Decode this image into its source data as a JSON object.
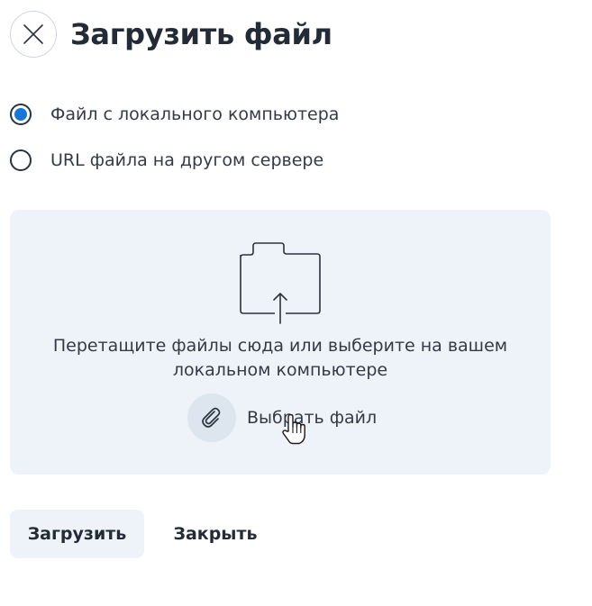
{
  "dialog": {
    "title": "Загрузить файл",
    "close_icon": "close-icon"
  },
  "source_options": [
    {
      "label": "Файл с локального компьютера",
      "selected": true
    },
    {
      "label": "URL файла на другом сервере",
      "selected": false
    }
  ],
  "dropzone": {
    "icon": "folder-upload-icon",
    "text_line1": "Перетащите файлы сюда или выберите на вашем",
    "text_line2": "локальном компьютере",
    "choose_icon": "paperclip-icon",
    "choose_label": "Выбрать файл"
  },
  "actions": {
    "upload_label": "Загрузить",
    "close_label": "Закрыть"
  },
  "colors": {
    "accent": "#1678d6",
    "panel_bg": "#eef2f9",
    "text": "#2b3340"
  }
}
